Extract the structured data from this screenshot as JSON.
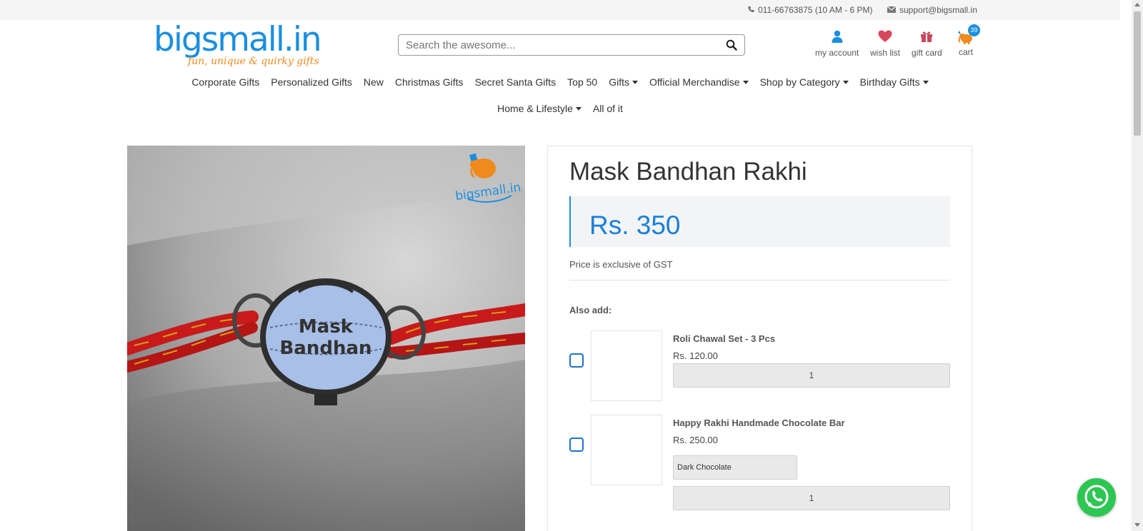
{
  "topbar": {
    "phone": "011-66763875 (10 AM - 6 PM)",
    "email": "support@bigsmall.in"
  },
  "logo": {
    "wordmark": "bigsmall.in",
    "tagline": "fun, unique & quirky gifts"
  },
  "search": {
    "placeholder": "Search the awesome..."
  },
  "header_icons": {
    "account_label": "my account",
    "wishlist_label": "wish list",
    "giftcard_label": "gift card",
    "cart_label": "cart",
    "cart_count": "39"
  },
  "nav": {
    "row1": [
      {
        "label": "Corporate Gifts",
        "dropdown": false
      },
      {
        "label": "Personalized Gifts",
        "dropdown": false
      },
      {
        "label": "New",
        "dropdown": false
      },
      {
        "label": "Christmas Gifts",
        "dropdown": false
      },
      {
        "label": "Secret Santa Gifts",
        "dropdown": false
      },
      {
        "label": "Top 50",
        "dropdown": false
      },
      {
        "label": "Gifts",
        "dropdown": true
      },
      {
        "label": "Official Merchandise",
        "dropdown": true
      },
      {
        "label": "Shop by Category",
        "dropdown": true
      },
      {
        "label": "Birthday Gifts",
        "dropdown": true
      }
    ],
    "row2": [
      {
        "label": "Home & Lifestyle",
        "dropdown": true
      },
      {
        "label": "All of it",
        "dropdown": false
      }
    ]
  },
  "product": {
    "title": "Mask Bandhan Rakhi",
    "price": "Rs. 350",
    "gst_note": "Price is exclusive of GST",
    "also_add_label": "Also add:",
    "image_text_line1": "Mask",
    "image_text_line2": "Bandhan",
    "image_watermark": "bigsmall.in"
  },
  "addons": [
    {
      "name": "Roli Chawal Set - 3 Pcs",
      "price": "Rs. 120.00",
      "quantity": "1",
      "checked": false
    },
    {
      "name": "Happy Rakhi Handmade Chocolate Bar",
      "price": "Rs. 250.00",
      "variant": "Dark Chocolate",
      "quantity": "1",
      "checked": false
    }
  ],
  "colors": {
    "brand_blue": "#1a8fe0",
    "brand_orange": "#f08a1c",
    "price_blue": "#1a7fd9",
    "whatsapp_green": "#2dc653"
  }
}
